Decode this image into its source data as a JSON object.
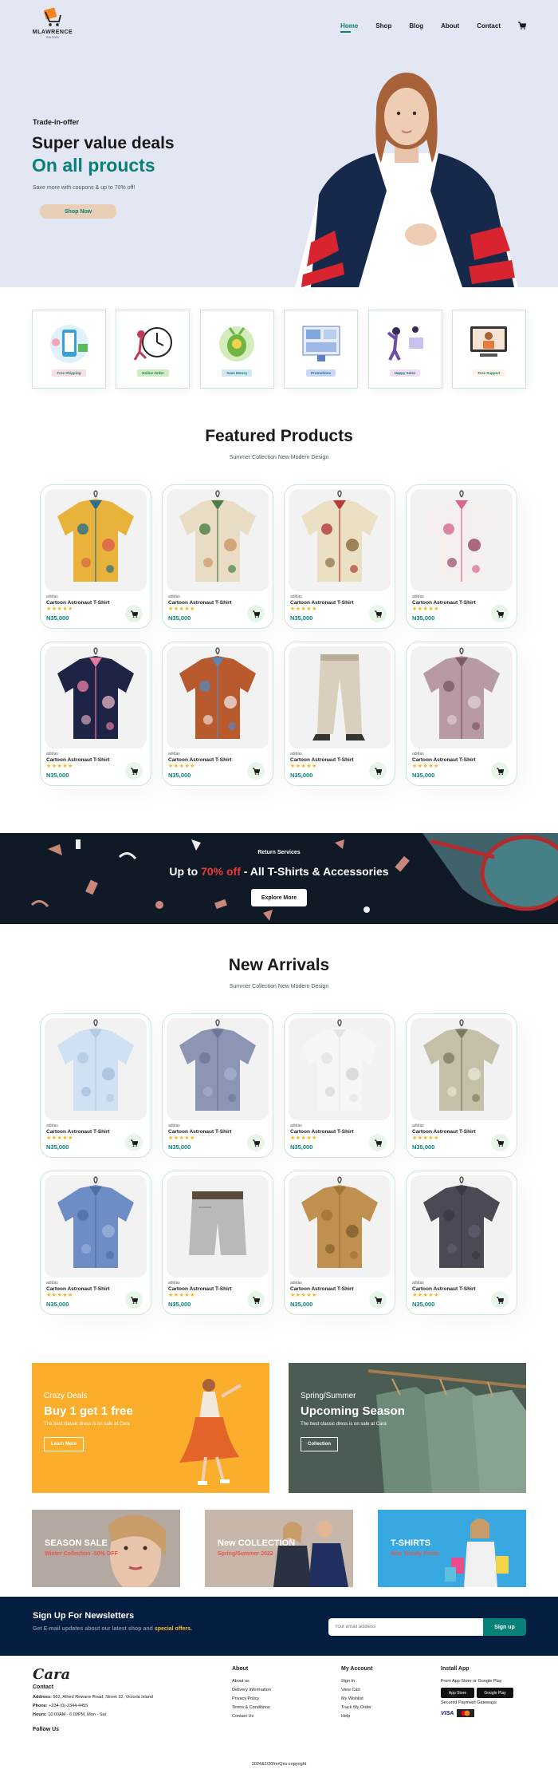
{
  "header": {
    "brand": "MLAWRENCE",
    "brand_sub": "Est 2023",
    "nav": [
      {
        "label": "Home",
        "active": true
      },
      {
        "label": "Shop",
        "active": false
      },
      {
        "label": "Blog",
        "active": false
      },
      {
        "label": "About",
        "active": false
      },
      {
        "label": "Contact",
        "active": false
      }
    ],
    "cart_icon": "shopping-bag-icon"
  },
  "hero": {
    "kicker": "Trade-in-offer",
    "title": "Super value deals",
    "highlight": "On all proucts",
    "subtitle": "Save more with coupons & up to 70% off!",
    "button": "Shop Now"
  },
  "features": [
    {
      "label": "Free Shipping",
      "color": "#fddde4"
    },
    {
      "label": "Online Order",
      "color": "#cdebbc"
    },
    {
      "label": "Save Money",
      "color": "#d1e8f2"
    },
    {
      "label": "Promotions",
      "color": "#cdd4f8"
    },
    {
      "label": "Happy Sales",
      "color": "#f6dbf6"
    },
    {
      "label": "Free Support",
      "color": "#fff2e5"
    }
  ],
  "featured": {
    "title": "Featured Products",
    "subtitle": "Summer Collection New Modern Design",
    "products": [
      {
        "brand": "adidas",
        "name": "Cartoon Astronaut T-Shirt",
        "stars": "★★★★★",
        "price": "N35,000",
        "image": "shirt-abstract-print"
      },
      {
        "brand": "adidas",
        "name": "Cartoon Astronaut T-Shirt",
        "stars": "★★★★★",
        "price": "N35,000",
        "image": "shirt-leaf-print"
      },
      {
        "brand": "adidas",
        "name": "Cartoon Astronaut T-Shirt",
        "stars": "★★★★★",
        "price": "N35,000",
        "image": "shirt-floral-print"
      },
      {
        "brand": "adidas",
        "name": "Cartoon Astronaut T-Shirt",
        "stars": "★★★★★",
        "price": "N35,000",
        "image": "shirt-pink-floral"
      },
      {
        "brand": "adidas",
        "name": "Cartoon Astronaut T-Shirt",
        "stars": "★★★★★",
        "price": "N35,000",
        "image": "shirt-navy-floral"
      },
      {
        "brand": "adidas",
        "name": "Cartoon Astronaut T-Shirt",
        "stars": "★★★★★",
        "price": "N35,000",
        "image": "shirt-denim-layered"
      },
      {
        "brand": "adidas",
        "name": "Cartoon Astronaut T-Shirt",
        "stars": "★★★★★",
        "price": "N35,000",
        "image": "trousers-beige"
      },
      {
        "brand": "adidas",
        "name": "Cartoon Astronaut T-Shirt",
        "stars": "★★★★★",
        "price": "N35,000",
        "image": "blouse-paisley"
      }
    ]
  },
  "promo": {
    "kicker": "Return Services",
    "title_pre": "Up to ",
    "title_red": "70% off",
    "title_post": " - All T-Shirts & Accessories",
    "button": "Explore More"
  },
  "arrivals": {
    "title": "New Arrivals",
    "subtitle": "Summer Collection New Modern Design",
    "products": [
      {
        "brand": "adidas",
        "name": "Cartoon Astronaut T-Shirt",
        "stars": "★★★★★",
        "price": "N35,000",
        "image": "shirt-light-blue"
      },
      {
        "brand": "adidas",
        "name": "Cartoon Astronaut T-Shirt",
        "stars": "★★★★★",
        "price": "N35,000",
        "image": "shirt-check-blue"
      },
      {
        "brand": "adidas",
        "name": "Cartoon Astronaut T-Shirt",
        "stars": "★★★★★",
        "price": "N35,000",
        "image": "shirt-white"
      },
      {
        "brand": "adidas",
        "name": "Cartoon Astronaut T-Shirt",
        "stars": "★★★★★",
        "price": "N35,000",
        "image": "shirt-khaki-print"
      },
      {
        "brand": "adidas",
        "name": "Cartoon Astronaut T-Shirt",
        "stars": "★★★★★",
        "price": "N35,000",
        "image": "shirt-denim"
      },
      {
        "brand": "adidas",
        "name": "Cartoon Astronaut T-Shirt",
        "stars": "★★★★★",
        "price": "N35,000",
        "image": "shorts-grey"
      },
      {
        "brand": "adidas",
        "name": "Cartoon Astronaut T-Shirt",
        "stars": "★★★★★",
        "price": "N35,000",
        "image": "jacket-tan"
      },
      {
        "brand": "adidas",
        "name": "Cartoon Astronaut T-Shirt",
        "stars": "★★★★★",
        "price": "N35,000",
        "image": "shirt-charcoal"
      }
    ]
  },
  "big_banners": [
    {
      "kicker": "Crazy Deals",
      "title": "Buy 1 get 1 free",
      "desc": "The best classic dress is on sale at Cara",
      "button": "Learn More"
    },
    {
      "kicker": "Spring/Summer",
      "title": "Upcoming Season",
      "desc": "The best classic dress is on sale at Cara",
      "button": "Collection"
    }
  ],
  "small_banners": [
    {
      "title": "SEASON SALE",
      "sub": "Winter Collection -50% OFF"
    },
    {
      "title": "New COLLECTION",
      "sub": "Spring/Summer 2022"
    },
    {
      "title": "T-SHIRTS",
      "sub": "New Trendy Prints"
    }
  ],
  "newsletter": {
    "title": "Sign Up For Newsletters",
    "text_pre": "Get E-mail updates about our latest shop and ",
    "text_highlight": "special offers.",
    "placeholder": "Your email address",
    "button": "Sign up"
  },
  "footer": {
    "logo": "Cara",
    "contact_title": "Contact",
    "address_label": "Address:",
    "address": "562, Alfred Rewane Road, Street 32, Victoria Island",
    "phone_label": "Phone:",
    "phone": "+234-(0)-2344-4455",
    "hours_label": "Hours:",
    "hours": "10:00AM - 6:00PM, Mon - Sat",
    "follow": "Follow Us",
    "about_title": "About",
    "about_links": [
      "About us",
      "Delivery Information",
      "Privacy Policy",
      "Terms & Conditions",
      "Contact Us"
    ],
    "account_title": "My Account",
    "account_links": [
      "Sign In",
      "View Cart",
      "My Wishlist",
      "Track My Order",
      "Help"
    ],
    "app_title": "Install App",
    "app_text": "From App Store or Google Play",
    "app_store": "App Store",
    "google_play": "Google Play",
    "gateways": "Secured Payment Gateways",
    "visa": "VISA",
    "copyright": "2024&2/20/mrQev copyright"
  }
}
